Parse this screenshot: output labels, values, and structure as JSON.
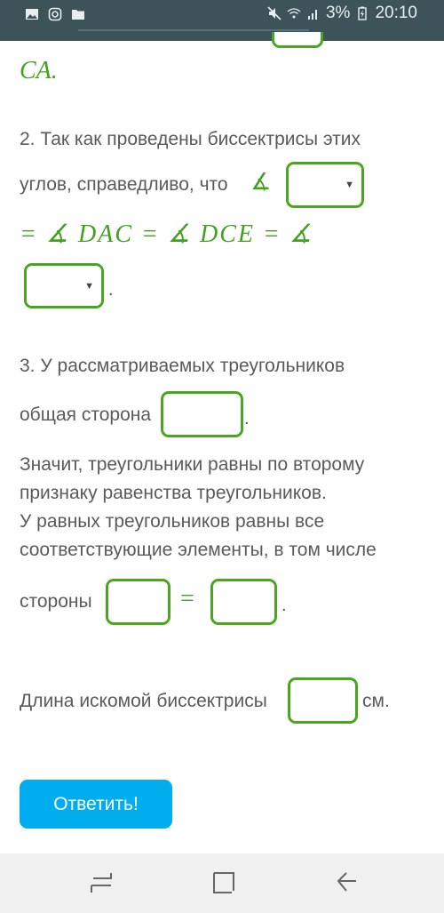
{
  "status_bar": {
    "battery": "3%",
    "time": "20:10",
    "left_icons": [
      "image-icon",
      "instagram-icon",
      "folder-icon"
    ],
    "right_icons": [
      "mute-icon",
      "wifi-icon",
      "signal-icon",
      "battery-icon"
    ]
  },
  "content": {
    "top_math": "CA.",
    "step2_line1": "2. Так как проведены биссектрисы этих",
    "step2_line2": "углов, справедливо, что",
    "angle_symbol": "∡",
    "math_chain": "= ∡ DAC = ∡ DCE = ∡",
    "period": ".",
    "step3_line1": "3. У рассматриваемых треугольников",
    "step3_line2": "общая сторона",
    "conclusion": [
      "Значит, треугольники равны по второму",
      "признаку равенства треугольников.",
      "У равных треугольников равны все",
      "соответствующие элементы, в том числе"
    ],
    "sides_label": "стороны",
    "equals": "=",
    "length_label": "Длина искомой биссектрисы",
    "unit": "см.",
    "inputs": {
      "select1_value": "",
      "select2_value": "",
      "common_side_value": "",
      "side1_value": "",
      "side2_value": "",
      "length_value": ""
    }
  },
  "submit_button": "Ответить!",
  "nav": {
    "recents": "recent-apps-icon",
    "home": "home-icon",
    "back": "back-icon"
  }
}
